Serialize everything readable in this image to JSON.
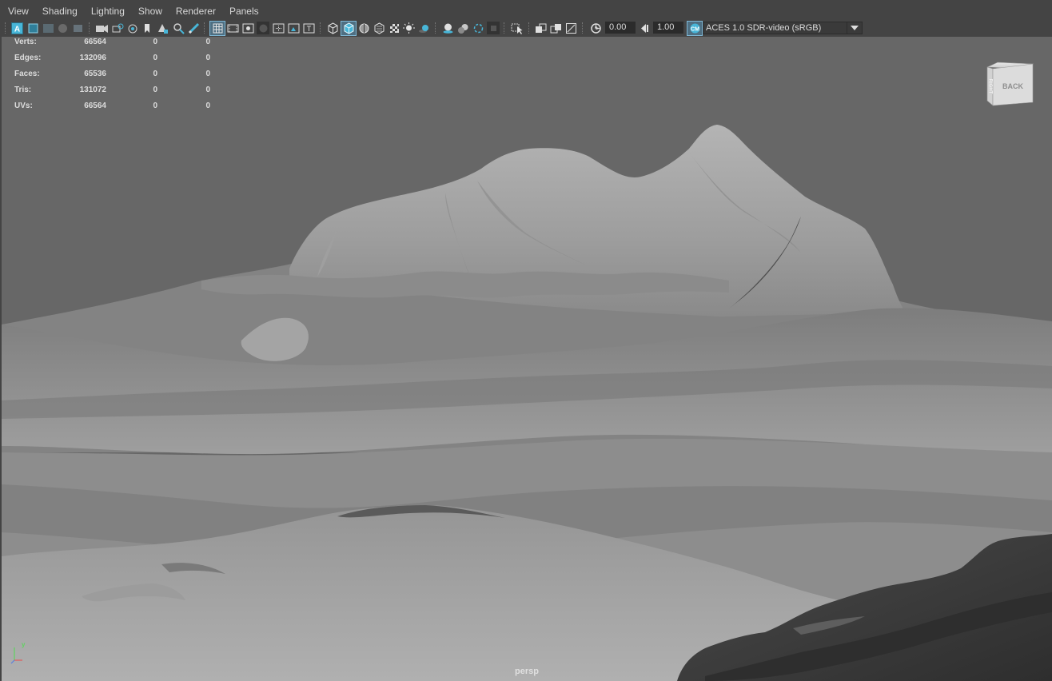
{
  "menu": [
    "View",
    "Shading",
    "Lighting",
    "Show",
    "Renderer",
    "Panels"
  ],
  "toolbar": {
    "exposure_value": "0.00",
    "gamma_value": "1.00",
    "color_space": "ACES 1.0 SDR-video (sRGB)",
    "icons": [
      "select-camera-icon",
      "camera-attributes-icon",
      "bookmarks-icon",
      "image-plane-icon",
      "2d-pan-zoom-icon",
      "grease-pencil-icon",
      "grid-icon",
      "film-gate-icon",
      "resolution-gate-icon",
      "gate-mask-icon",
      "field-chart-icon",
      "safe-action-icon",
      "safe-title-icon",
      "wireframe-icon",
      "smooth-shade-icon",
      "wireframe-on-shaded-icon",
      "xray-icon",
      "textured-icon",
      "use-all-lights-icon",
      "shadows-icon",
      "screen-space-ao-icon",
      "motion-blur-icon",
      "anti-aliasing-icon",
      "depth-of-field-icon",
      "isolate-select-icon",
      "xray-joints-icon",
      "exposure-icon",
      "gamma-icon",
      "color-management-icon",
      "dropdown-arrow-icon"
    ],
    "accent_color": "#48b6d8"
  },
  "hud": {
    "rows": [
      {
        "label": "Verts:",
        "c1": "66564",
        "c2": "0",
        "c3": "0"
      },
      {
        "label": "Edges:",
        "c1": "132096",
        "c2": "0",
        "c3": "0"
      },
      {
        "label": "Faces:",
        "c1": "65536",
        "c2": "0",
        "c3": "0"
      },
      {
        "label": "Tris:",
        "c1": "131072",
        "c2": "0",
        "c3": "0"
      },
      {
        "label": "UVs:",
        "c1": "66564",
        "c2": "0",
        "c3": "0"
      }
    ]
  },
  "viewcube": {
    "face": "BACK",
    "side": "RIGHT"
  },
  "camera_label": "persp",
  "axis": {
    "y_label": "y"
  },
  "colors": {
    "viewport_bg": "#676767",
    "ui_bg": "#444444",
    "terrain_light": "#a6a6a6",
    "terrain_dark": "#3e3e3e"
  }
}
